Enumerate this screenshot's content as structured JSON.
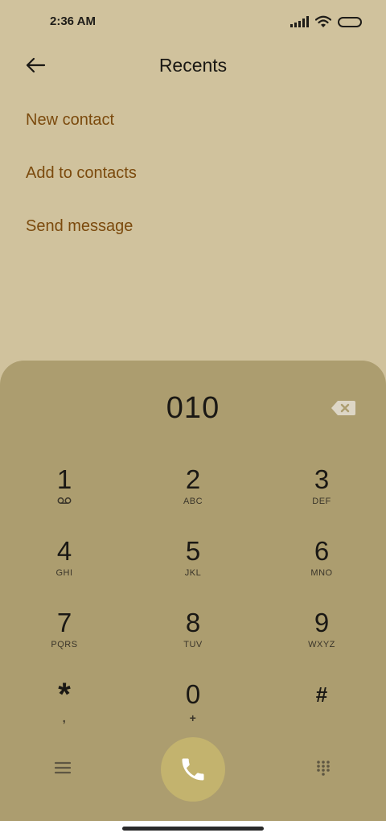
{
  "status_bar": {
    "time": "2:36 AM"
  },
  "header": {
    "title": "Recents"
  },
  "actions": [
    {
      "label": "New contact"
    },
    {
      "label": "Add to contacts"
    },
    {
      "label": "Send message"
    }
  ],
  "dialpad": {
    "number": "010",
    "keys": [
      {
        "digit": "1",
        "sub": ""
      },
      {
        "digit": "2",
        "sub": "ABC"
      },
      {
        "digit": "3",
        "sub": "DEF"
      },
      {
        "digit": "4",
        "sub": "GHI"
      },
      {
        "digit": "5",
        "sub": "JKL"
      },
      {
        "digit": "6",
        "sub": "MNO"
      },
      {
        "digit": "7",
        "sub": "PQRS"
      },
      {
        "digit": "8",
        "sub": "TUV"
      },
      {
        "digit": "9",
        "sub": "WXYZ"
      },
      {
        "digit": "*",
        "sub": ","
      },
      {
        "digit": "0",
        "sub": "+"
      },
      {
        "digit": "#",
        "sub": ""
      }
    ]
  },
  "colors": {
    "background": "#d0c29d",
    "dialpad": "#ac9d6f",
    "accent_text": "#7b4a0d",
    "call_button": "#c3b36e"
  },
  "icons": {
    "back": "back-arrow-icon",
    "backspace": "backspace-icon",
    "voicemail": "voicemail-icon",
    "menu": "menu-icon",
    "call": "phone-icon",
    "dialpad_toggle": "dialpad-grid-icon"
  }
}
